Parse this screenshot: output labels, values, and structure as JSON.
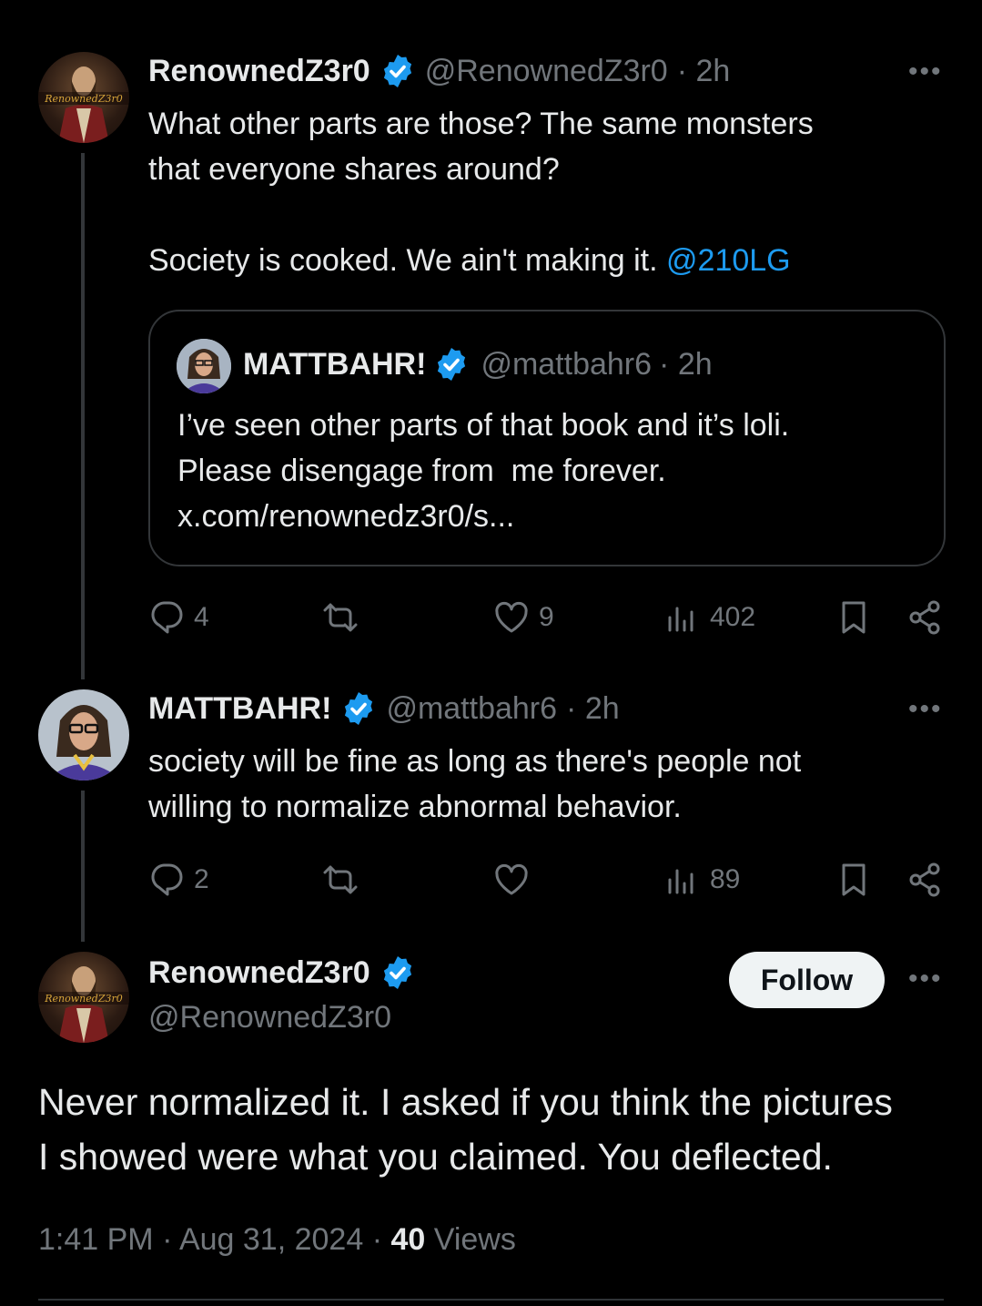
{
  "tweet1": {
    "name": "RenownedZ3r0",
    "handle": "@RenownedZ3r0",
    "time": "· 2h",
    "text_line1": "What other parts are those? The same monsters",
    "text_line2": "that everyone shares around?",
    "text_line3": "Society is cooked. We ain't making it.",
    "mention": "@210LG",
    "avatar_text": "RenownedZ3r0",
    "quote": {
      "name": "MATTBAHR!",
      "handle": "@mattbahr6",
      "time": "· 2h",
      "line1": "I’ve seen other parts of that book and it’s loli.",
      "line2": "Please disengage from  me forever.",
      "line3": "x.com/renownedz3r0/s..."
    },
    "stats": {
      "replies": "4",
      "likes": "9",
      "views": "402"
    }
  },
  "tweet2": {
    "name": "MATTBAHR!",
    "handle": "@mattbahr6",
    "time": "· 2h",
    "line1": "society will be fine as long as there's people not",
    "line2": "willing to normalize abnormal behavior.",
    "stats": {
      "replies": "2",
      "views": "89"
    }
  },
  "main": {
    "name": "RenownedZ3r0",
    "handle": "@RenownedZ3r0",
    "follow_label": "Follow",
    "line1": "Never normalized it. I asked if you think the pictures",
    "line2": "I showed were what you claimed. You deflected.",
    "timestamp": "1:41 PM · Aug 31, 2024 ·",
    "views_count": "40",
    "views_label": "Views",
    "avatar_text": "RenownedZ3r0"
  },
  "more_label": "•••",
  "colors": {
    "accent": "#1d9bf0",
    "muted": "#71767b",
    "border": "#333639"
  },
  "icons": [
    "reply-icon",
    "retweet-icon",
    "like-icon",
    "views-icon",
    "bookmark-icon",
    "share-icon",
    "verified-icon",
    "more-icon"
  ]
}
